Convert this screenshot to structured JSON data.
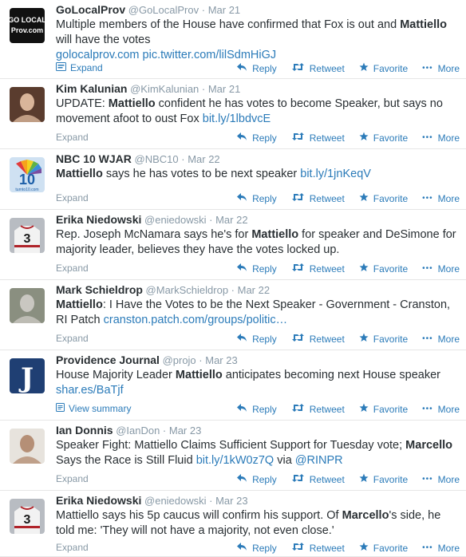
{
  "actions": {
    "reply": "Reply",
    "retweet": "Retweet",
    "favorite": "Favorite",
    "more": "More"
  },
  "tweets": [
    {
      "name": "GoLocalProv",
      "handle": "@GoLocalProv",
      "time": "Mar 21",
      "avatar": {
        "kind": "golocal",
        "line1": "GO LOCAL",
        "line2": "Prov.com"
      },
      "segments": [
        {
          "t": "Multiple members of the House have confirmed that Fox is out and "
        },
        {
          "t": "Mattiello",
          "s": "hl"
        },
        {
          "t": " will have the votes"
        },
        {
          "br": true
        },
        {
          "t": "golocalprov.com pic.twitter.com/lilSdmHiGJ",
          "s": "lnk"
        }
      ],
      "expand": "Expand",
      "expand_type": "media"
    },
    {
      "name": "Kim Kalunian",
      "handle": "@KimKalunian",
      "time": "Mar 21",
      "avatar": {
        "kind": "photo",
        "bg": "#5a3c2e",
        "fg": "#d9b59a"
      },
      "segments": [
        {
          "t": "UPDATE: "
        },
        {
          "t": "Mattiello",
          "s": "hl"
        },
        {
          "t": " confident he has votes to become Speaker, but says no movement afoot to oust Fox "
        },
        {
          "t": "bit.ly/1lbdvcE",
          "s": "lnk"
        }
      ],
      "expand": "Expand",
      "expand_type": "plain"
    },
    {
      "name": "NBC 10 WJAR",
      "handle": "@NBC10",
      "time": "Mar 22",
      "avatar": {
        "kind": "nbc",
        "label": "10",
        "sub": "turnto10.com"
      },
      "segments": [
        {
          "t": "Mattiello",
          "s": "hl"
        },
        {
          "t": " says he has votes to be next speaker "
        },
        {
          "t": "bit.ly/1jnKeqV",
          "s": "lnk"
        }
      ],
      "expand": "Expand",
      "expand_type": "plain"
    },
    {
      "name": "Erika Niedowski",
      "handle": "@eniedowski",
      "time": "Mar 22",
      "avatar": {
        "kind": "jersey",
        "label": "3"
      },
      "segments": [
        {
          "t": "Rep. Joseph McNamara says he's for "
        },
        {
          "t": "Mattiello",
          "s": "hl"
        },
        {
          "t": " for speaker and DeSimone for majority leader, believes they have the votes locked up."
        }
      ],
      "expand": "Expand",
      "expand_type": "plain"
    },
    {
      "name": "Mark Schieldrop",
      "handle": "@MarkSchieldrop",
      "time": "Mar 22",
      "avatar": {
        "kind": "photo",
        "bg": "#8a8f80",
        "fg": "#c9c7c1"
      },
      "segments": [
        {
          "t": "Mattiello",
          "s": "hl"
        },
        {
          "t": ": I Have the Votes to be the Next Speaker - Government - Cranston, RI Patch "
        },
        {
          "t": "cranston.patch.com/groups/politic…",
          "s": "lnk"
        }
      ],
      "expand": "Expand",
      "expand_type": "plain"
    },
    {
      "name": "Providence Journal",
      "handle": "@projo",
      "time": "Mar 23",
      "avatar": {
        "kind": "projo",
        "label": "J"
      },
      "segments": [
        {
          "t": "House Majority Leader "
        },
        {
          "t": "Mattiello",
          "s": "hl"
        },
        {
          "t": " anticipates becoming next House speaker"
        },
        {
          "br": true
        },
        {
          "t": "shar.es/BaTjf",
          "s": "lnk"
        }
      ],
      "expand": "View summary",
      "expand_type": "summary"
    },
    {
      "name": "Ian Donnis",
      "handle": "@IanDon",
      "time": "Mar 23",
      "avatar": {
        "kind": "photo",
        "bg": "#e7e3dd",
        "fg": "#b58f76"
      },
      "segments": [
        {
          "t": "Speaker Fight: Mattiello Claims Sufficient Support for Tuesday vote; "
        },
        {
          "t": "Marcello",
          "s": "hl"
        },
        {
          "t": " Says the Race is Still Fluid "
        },
        {
          "t": "bit.ly/1kW0z7Q",
          "s": "lnk"
        },
        {
          "t": " via "
        },
        {
          "t": "@RINPR",
          "s": "lnk"
        }
      ],
      "expand": "Expand",
      "expand_type": "plain"
    },
    {
      "name": "Erika Niedowski",
      "handle": "@eniedowski",
      "time": "Mar 23",
      "avatar": {
        "kind": "jersey",
        "label": "3"
      },
      "segments": [
        {
          "t": "Mattiello says his 5p caucus will confirm his support. Of "
        },
        {
          "t": "Marcello",
          "s": "hl"
        },
        {
          "t": "'s side, he told me: 'They will not have a majority, not even close.'"
        }
      ],
      "expand": "Expand",
      "expand_type": "plain"
    }
  ]
}
